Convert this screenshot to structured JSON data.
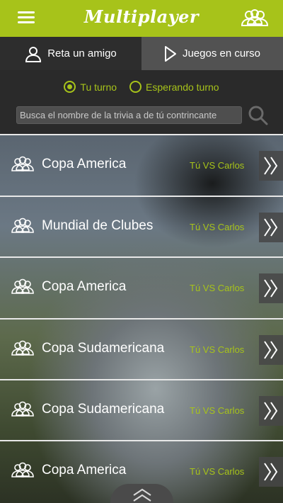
{
  "header": {
    "title": "Multiplayer",
    "menu_icon": "hamburger-icon",
    "friends_icon": "users-icon",
    "accent_color": "#a7c31a"
  },
  "tabs": [
    {
      "label": "Reta un amigo",
      "icon": "user-icon"
    },
    {
      "label": "Juegos en curso",
      "icon": "play-icon"
    }
  ],
  "filter": {
    "options": [
      {
        "label": "Tu turno",
        "selected": true
      },
      {
        "label": "Esperando turno",
        "selected": false
      }
    ],
    "search_placeholder": "Busca el nombre de la trivia a de tú contrincante",
    "search_icon": "search-icon"
  },
  "games": [
    {
      "title": "Copa America",
      "versus": "Tú VS Carlos"
    },
    {
      "title": "Mundial de Clubes",
      "versus": "Tú VS Carlos"
    },
    {
      "title": "Copa America",
      "versus": "Tú VS Carlos"
    },
    {
      "title": "Copa Sudamericana",
      "versus": "Tú VS Carlos"
    },
    {
      "title": "Copa Sudamericana",
      "versus": "Tú VS Carlos"
    },
    {
      "title": "Copa America",
      "versus": "Tú VS Carlos"
    }
  ]
}
